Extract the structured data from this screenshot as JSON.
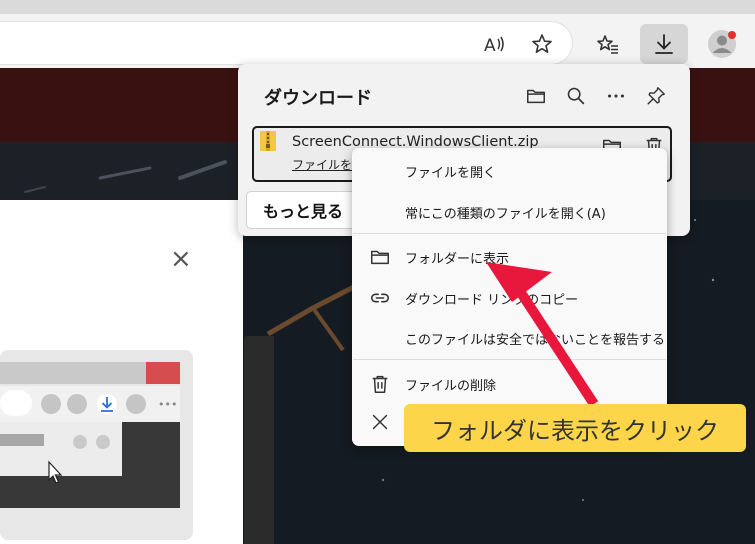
{
  "browser": {
    "icons": [
      "read-aloud-icon",
      "favorite-star-icon",
      "favorites-list-icon",
      "download-icon",
      "profile-avatar-icon"
    ],
    "download_active_color": "#d6d6d6"
  },
  "downloads_panel": {
    "title": "ダウンロード",
    "icons": [
      "open-folder-icon",
      "search-icon",
      "more-options-icon",
      "pin-icon"
    ],
    "item": {
      "file_name": "ScreenConnect.WindowsClient.zip",
      "open_link": "ファイルを開く"
    },
    "see_more": "もっと見る"
  },
  "context_menu": {
    "items": [
      {
        "label": "ファイルを開く",
        "icon": ""
      },
      {
        "label": "常にこの種類のファイルを開く(A)",
        "icon": ""
      },
      {
        "label": "フォルダーに表示",
        "icon": "folder-icon"
      },
      {
        "label": "ダウンロード リンクのコピー",
        "icon": "link-icon"
      },
      {
        "label": "このファイルは安全ではないことを報告する",
        "icon": ""
      },
      {
        "label": "ファイルの削除",
        "icon": "trash-icon"
      }
    ]
  },
  "annotation": {
    "callout_text": "フォルダに表示をクリック",
    "arrow_color": "#e8173c",
    "callout_color": "#fdd54a"
  },
  "page": {
    "dialog_close": "×"
  }
}
